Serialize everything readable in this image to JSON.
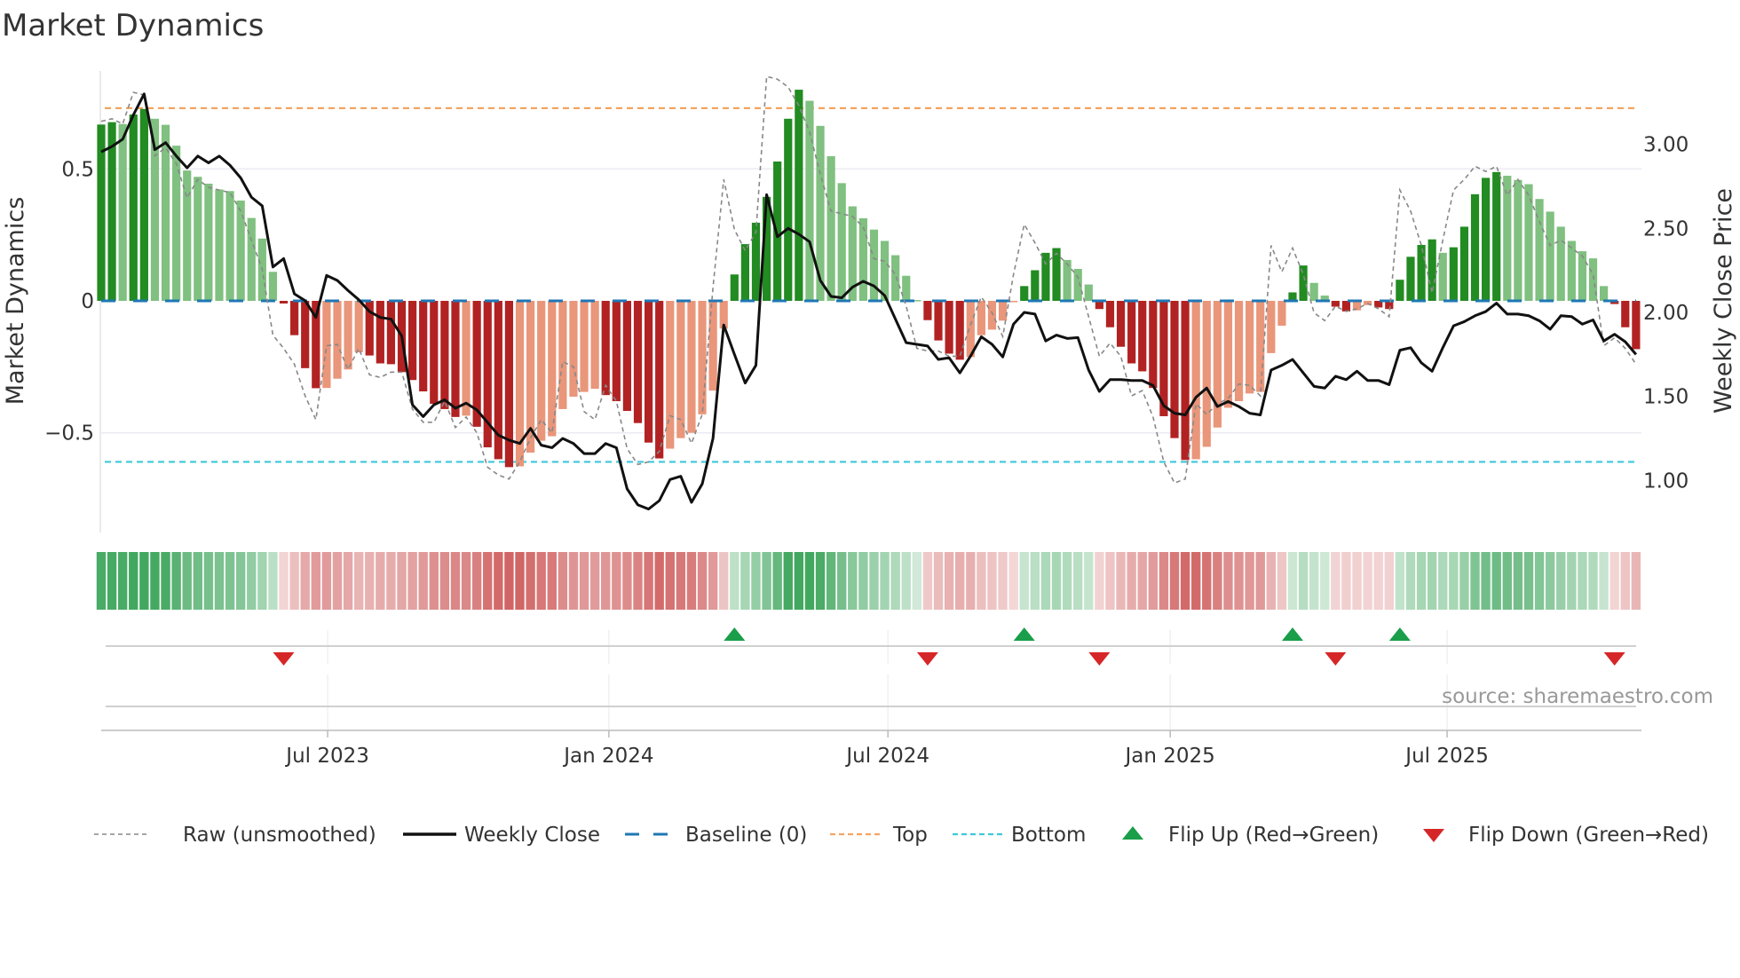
{
  "title": "Market Dynamics",
  "source": "source: sharemaestro.com",
  "colors": {
    "green_dark": "#228b22",
    "green_light": "#80c080",
    "red_dark": "#b22222",
    "red_light": "#e9967a",
    "baseline": "#1f77b4",
    "top": "#f4a460",
    "bottom": "#3cc8d8",
    "flip_up": "#1a9e4a",
    "flip_down": "#d62728",
    "price": "#111111",
    "raw": "#888888"
  },
  "legend": [
    {
      "label": "Raw (unsmoothed)",
      "kind": "raw"
    },
    {
      "label": "Weekly Close",
      "kind": "price"
    },
    {
      "label": "Baseline (0)",
      "kind": "baseline"
    },
    {
      "label": "Top",
      "kind": "top"
    },
    {
      "label": "Bottom",
      "kind": "bottom"
    },
    {
      "label": "Flip Up (Red→Green)",
      "kind": "flip_up"
    },
    {
      "label": "Flip Down (Green→Red)",
      "kind": "flip_down"
    }
  ],
  "chart_data": {
    "type": "bar",
    "title": "Market Dynamics",
    "x_unit": "week index",
    "xticks": [
      {
        "label": "Jul 2023",
        "x": 21.1
      },
      {
        "label": "Jan 2024",
        "x": 47.3
      },
      {
        "label": "Jul 2024",
        "x": 73.3
      },
      {
        "label": "Jan 2025",
        "x": 99.6
      },
      {
        "label": "Jul 2025",
        "x": 125.4
      }
    ],
    "ylabel": "Market Dynamics",
    "ylim": [
      -0.88,
      0.87
    ],
    "yticks": [
      {
        "label": "0.5",
        "v": 0.5
      },
      {
        "label": "0",
        "v": 0
      },
      {
        "label": "−0.5",
        "v": -0.5
      }
    ],
    "y2label": "Weekly Close Price",
    "y2lim": [
      0.62,
      3.38
    ],
    "y2ticks": [
      {
        "label": "3.00",
        "v": 3.0
      },
      {
        "label": "2.50",
        "v": 2.5
      },
      {
        "label": "2.00",
        "v": 2.0
      },
      {
        "label": "1.50",
        "v": 1.5
      },
      {
        "label": "1.00",
        "v": 1.0
      }
    ],
    "levels": {
      "top": 0.73,
      "bottom": -0.61,
      "baseline": 0
    },
    "grid": true,
    "legend_position": "bottom",
    "series": [
      {
        "name": "Market Dynamics",
        "kind": "bar",
        "values": [
          0.668,
          0.677,
          0.67,
          0.706,
          0.727,
          0.69,
          0.667,
          0.588,
          0.494,
          0.47,
          0.444,
          0.422,
          0.416,
          0.38,
          0.314,
          0.236,
          0.11,
          -0.01,
          -0.13,
          -0.255,
          -0.331,
          -0.33,
          -0.295,
          -0.26,
          -0.195,
          -0.207,
          -0.237,
          -0.24,
          -0.27,
          -0.3,
          -0.343,
          -0.39,
          -0.41,
          -0.44,
          -0.435,
          -0.477,
          -0.555,
          -0.6,
          -0.63,
          -0.627,
          -0.575,
          -0.53,
          -0.513,
          -0.41,
          -0.363,
          -0.345,
          -0.333,
          -0.357,
          -0.38,
          -0.417,
          -0.463,
          -0.537,
          -0.597,
          -0.56,
          -0.52,
          -0.5,
          -0.43,
          -0.34,
          -0.105,
          0.1,
          0.215,
          0.296,
          0.394,
          0.528,
          0.69,
          0.8,
          0.758,
          0.663,
          0.548,
          0.446,
          0.358,
          0.313,
          0.27,
          0.227,
          0.173,
          0.095,
          0.003,
          -0.073,
          -0.15,
          -0.2,
          -0.223,
          -0.213,
          -0.13,
          -0.109,
          -0.075,
          -0.005,
          0.056,
          0.116,
          0.182,
          0.2,
          0.155,
          0.121,
          0.062,
          -0.031,
          -0.1,
          -0.174,
          -0.237,
          -0.267,
          -0.33,
          -0.437,
          -0.52,
          -0.603,
          -0.6,
          -0.553,
          -0.48,
          -0.405,
          -0.38,
          -0.351,
          -0.345,
          -0.198,
          -0.094,
          0.032,
          0.134,
          0.068,
          0.02,
          -0.022,
          -0.04,
          -0.036,
          -0.016,
          -0.025,
          -0.031,
          0.08,
          0.167,
          0.212,
          0.233,
          0.182,
          0.203,
          0.281,
          0.404,
          0.466,
          0.488,
          0.474,
          0.458,
          0.442,
          0.386,
          0.338,
          0.281,
          0.227,
          0.188,
          0.161,
          0.056,
          -0.012,
          -0.1,
          -0.183
        ]
      },
      {
        "name": "Raw (unsmoothed)",
        "kind": "line",
        "values": [
          0.68,
          0.69,
          0.67,
          0.79,
          0.78,
          0.55,
          0.58,
          0.52,
          0.39,
          0.46,
          0.43,
          0.42,
          0.41,
          0.34,
          0.23,
          0.12,
          -0.13,
          -0.18,
          -0.24,
          -0.36,
          -0.45,
          -0.17,
          -0.165,
          -0.26,
          -0.18,
          -0.28,
          -0.29,
          -0.27,
          -0.27,
          -0.41,
          -0.46,
          -0.46,
          -0.38,
          -0.48,
          -0.44,
          -0.5,
          -0.63,
          -0.66,
          -0.675,
          -0.61,
          -0.52,
          -0.45,
          -0.5,
          -0.23,
          -0.25,
          -0.42,
          -0.45,
          -0.32,
          -0.38,
          -0.56,
          -0.62,
          -0.61,
          -0.57,
          -0.435,
          -0.45,
          -0.54,
          -0.43,
          0.05,
          0.46,
          0.27,
          0.19,
          0.26,
          0.85,
          0.84,
          0.81,
          0.74,
          0.64,
          0.48,
          0.34,
          0.33,
          0.32,
          0.28,
          0.16,
          0.15,
          0.1,
          -0.02,
          -0.18,
          -0.19,
          -0.19,
          -0.21,
          -0.21,
          -0.09,
          0.015,
          -0.045,
          -0.135,
          0.1,
          0.29,
          0.22,
          0.14,
          0.18,
          0.14,
          0.09,
          -0.06,
          -0.21,
          -0.16,
          -0.21,
          -0.36,
          -0.34,
          -0.44,
          -0.61,
          -0.69,
          -0.675,
          -0.39,
          -0.43,
          -0.39,
          -0.37,
          -0.315,
          -0.32,
          -0.36,
          0.21,
          0.11,
          0.2,
          0.1,
          -0.045,
          -0.075,
          -0.02,
          -0.04,
          -0.03,
          -0.01,
          -0.03,
          -0.06,
          0.42,
          0.34,
          0.21,
          0.03,
          0.23,
          0.42,
          0.46,
          0.51,
          0.49,
          0.51,
          0.4,
          0.46,
          0.4,
          0.3,
          0.21,
          0.23,
          0.2,
          0.17,
          0.1,
          -0.17,
          -0.14,
          -0.18,
          -0.24
        ]
      },
      {
        "name": "Weekly Close",
        "kind": "line",
        "axis": "right",
        "values": [
          2.955,
          2.987,
          3.03,
          3.175,
          3.3,
          2.968,
          3.01,
          2.93,
          2.86,
          2.93,
          2.89,
          2.93,
          2.875,
          2.8,
          2.685,
          2.634,
          2.27,
          2.32,
          2.11,
          2.07,
          1.97,
          2.22,
          2.19,
          2.13,
          2.075,
          2.005,
          1.97,
          1.96,
          1.86,
          1.45,
          1.38,
          1.45,
          1.48,
          1.43,
          1.46,
          1.42,
          1.345,
          1.27,
          1.24,
          1.22,
          1.31,
          1.21,
          1.195,
          1.25,
          1.22,
          1.16,
          1.16,
          1.22,
          1.195,
          0.95,
          0.855,
          0.83,
          0.88,
          1.006,
          1.025,
          0.87,
          0.98,
          1.25,
          1.925,
          1.75,
          1.58,
          1.685,
          2.7,
          2.45,
          2.5,
          2.465,
          2.42,
          2.19,
          2.095,
          2.087,
          2.15,
          2.185,
          2.157,
          2.1,
          1.96,
          1.82,
          1.81,
          1.8,
          1.72,
          1.73,
          1.64,
          1.74,
          1.855,
          1.81,
          1.735,
          1.93,
          2.0,
          1.99,
          1.83,
          1.865,
          1.845,
          1.85,
          1.657,
          1.53,
          1.6,
          1.6,
          1.595,
          1.595,
          1.565,
          1.445,
          1.4,
          1.39,
          1.495,
          1.55,
          1.44,
          1.47,
          1.44,
          1.4,
          1.39,
          1.657,
          1.685,
          1.72,
          1.64,
          1.56,
          1.55,
          1.62,
          1.6,
          1.65,
          1.595,
          1.595,
          1.57,
          1.775,
          1.79,
          1.7,
          1.65,
          1.79,
          1.92,
          1.945,
          1.98,
          2.005,
          2.055,
          1.99,
          1.99,
          1.98,
          1.95,
          1.9,
          1.98,
          1.975,
          1.93,
          1.955,
          1.83,
          1.87,
          1.825,
          1.75
        ]
      }
    ],
    "flips_up": [
      59,
      86,
      111,
      121
    ],
    "flips_down": [
      17,
      77,
      93,
      115,
      141
    ]
  }
}
